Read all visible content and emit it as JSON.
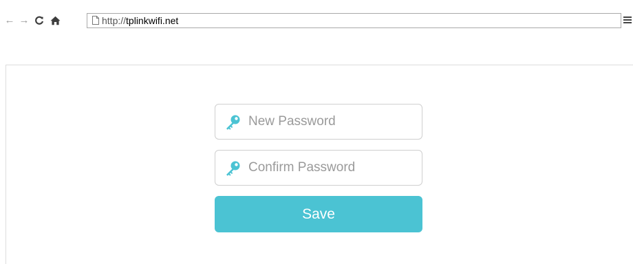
{
  "browser": {
    "url_prefix": "http://",
    "url_host": "tplinkwifi.net",
    "icons": [
      "back-arrow-icon",
      "forward-arrow-icon",
      "reload-icon",
      "home-icon",
      "page-icon",
      "menu-icon"
    ]
  },
  "form": {
    "new_password": {
      "value": "",
      "placeholder": "New Password",
      "icon": "key-icon"
    },
    "confirm_password": {
      "value": "",
      "placeholder": "Confirm Password",
      "icon": "key-icon"
    },
    "save_label": "Save"
  },
  "colors": {
    "accent": "#4bc3d3",
    "key_icon": "#4bc3d3",
    "field_border": "#cfcfcf",
    "placeholder": "#9a9a9a"
  }
}
